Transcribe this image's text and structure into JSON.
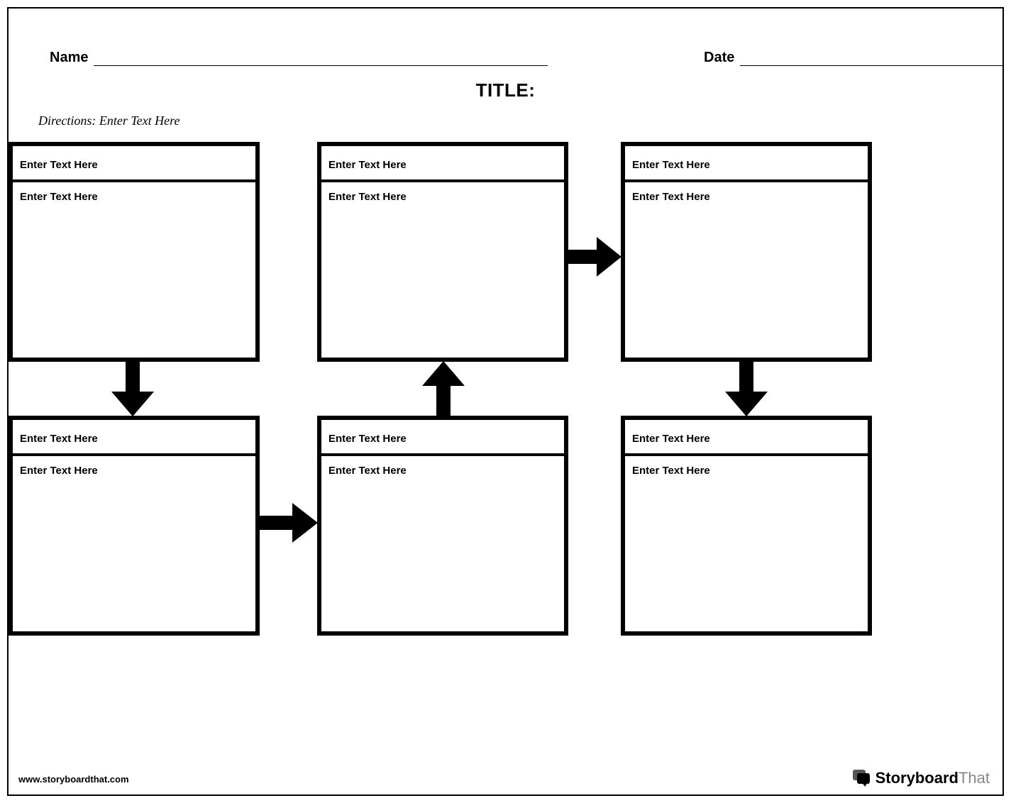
{
  "header": {
    "name_label": "Name",
    "date_label": "Date",
    "title_label": "TITLE:"
  },
  "directions": {
    "prefix": "Directions:",
    "text": "Enter Text Here"
  },
  "boxes": [
    {
      "title": "Enter Text Here",
      "body": "Enter Text Here"
    },
    {
      "title": "Enter Text Here",
      "body": "Enter Text Here"
    },
    {
      "title": "Enter Text Here",
      "body": "Enter Text Here"
    },
    {
      "title": "Enter Text Here",
      "body": "Enter Text Here"
    },
    {
      "title": "Enter Text Here",
      "body": "Enter Text Here"
    },
    {
      "title": "Enter Text Here",
      "body": "Enter Text Here"
    }
  ],
  "footer": {
    "url": "www.storyboardthat.com",
    "logo_bold": "Storyboard",
    "logo_light": "That"
  }
}
